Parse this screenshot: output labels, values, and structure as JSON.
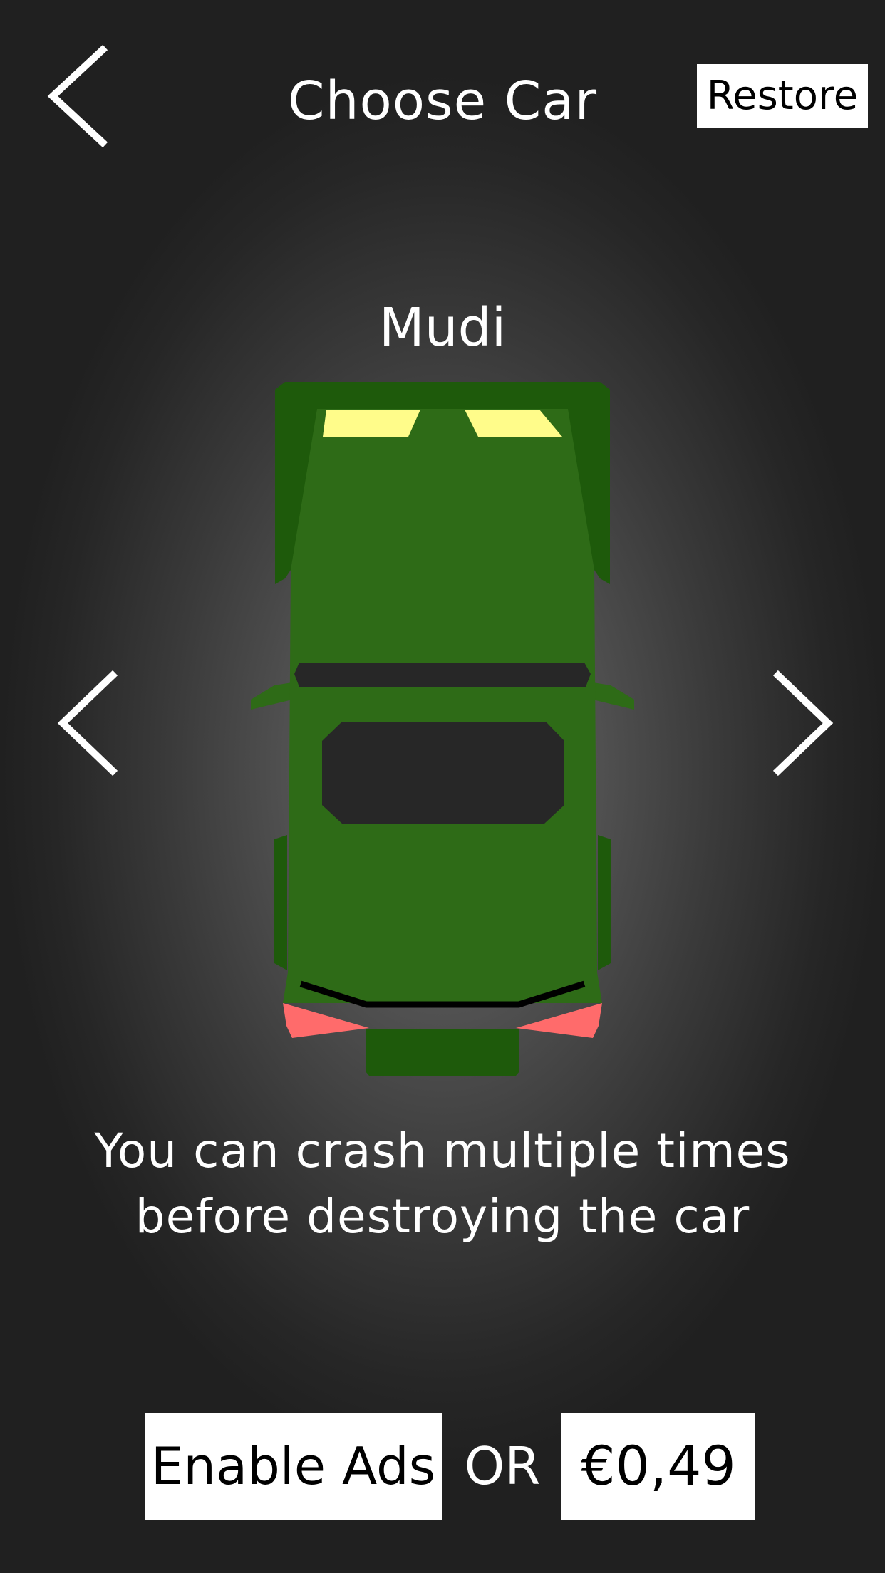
{
  "header": {
    "back_icon": "chevron-left-icon",
    "title": "Choose Car",
    "restore_label": "Restore"
  },
  "car": {
    "name": "Mudi",
    "colors": {
      "body": "#2e6b17",
      "body_dark": "#1e5a0b",
      "headlights": "#fffc8a",
      "windows": "#272727",
      "taillights": "#ff6b6b",
      "grille": "#000000"
    },
    "description_line1": "You can crash multiple times",
    "description_line2": "before destroying the car"
  },
  "navigation": {
    "prev_icon": "chevron-left-icon",
    "next_icon": "chevron-right-icon"
  },
  "purchase": {
    "enable_ads_label": "Enable Ads",
    "or_label": "OR",
    "price_label": "€0,49"
  }
}
